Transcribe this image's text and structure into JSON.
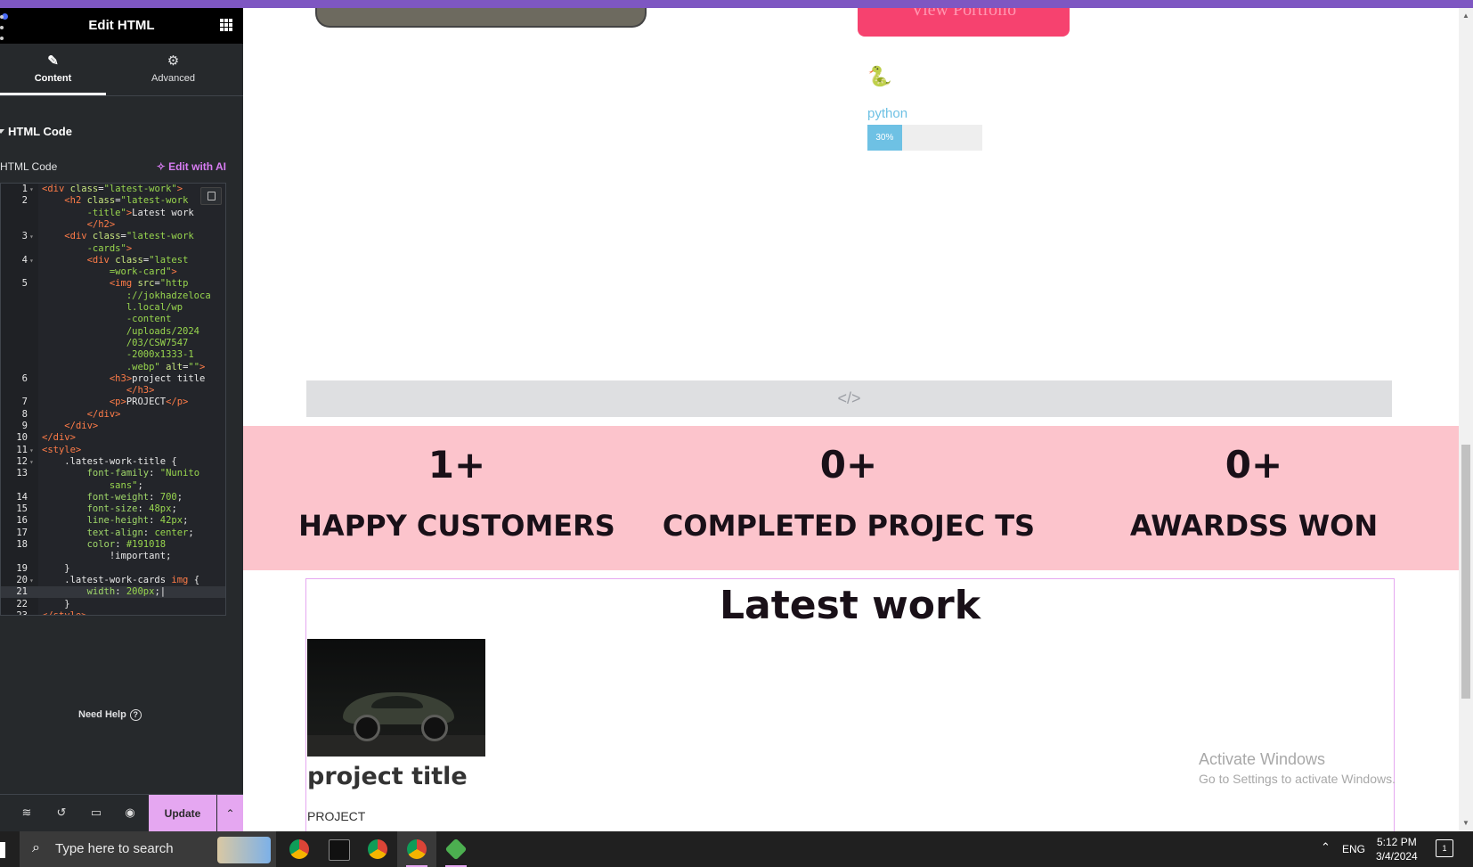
{
  "panel": {
    "title": "Edit HTML",
    "tabs": [
      {
        "label": "Content",
        "icon": "pencil-icon"
      },
      {
        "label": "Advanced",
        "icon": "gear-icon"
      }
    ],
    "section_title": "HTML Code",
    "code_label": "HTML Code",
    "edit_ai_label": "✧ Edit with AI",
    "need_help": "Need Help",
    "update_label": "Update",
    "code_lines": [
      {
        "n": "1",
        "fold": true,
        "html": "<span class=\"t-tag\">&lt;div</span> <span class=\"t-attr\">class</span>=<span class=\"t-str\">\"latest-work\"</span><span class=\"t-tag\">&gt;</span>"
      },
      {
        "n": "2",
        "fold": false,
        "html": "    <span class=\"t-tag\">&lt;h2</span> <span class=\"t-attr\">class</span>=<span class=\"t-str\">\"latest-work</span>"
      },
      {
        "n": "",
        "fold": false,
        "html": "        <span class=\"t-str\">-title\"</span><span class=\"t-tag\">&gt;</span>Latest work"
      },
      {
        "n": "",
        "fold": false,
        "html": "        <span class=\"t-tag\">&lt;/h2&gt;</span>"
      },
      {
        "n": "3",
        "fold": true,
        "html": "    <span class=\"t-tag\">&lt;div</span> <span class=\"t-attr\">class</span>=<span class=\"t-str\">\"latest-work</span>"
      },
      {
        "n": "",
        "fold": false,
        "html": "        <span class=\"t-str\">-cards\"</span><span class=\"t-tag\">&gt;</span>"
      },
      {
        "n": "4",
        "fold": true,
        "html": "        <span class=\"t-tag\">&lt;div</span> <span class=\"t-attr\">class</span>=<span class=\"t-str\">\"latest</span>"
      },
      {
        "n": "",
        "fold": false,
        "html": "            <span class=\"t-str\">=work-card\"</span><span class=\"t-tag\">&gt;</span>"
      },
      {
        "n": "5",
        "fold": false,
        "html": "            <span class=\"t-tag\">&lt;img</span> <span class=\"t-attr\">src</span>=<span class=\"t-str\">\"http</span>"
      },
      {
        "n": "",
        "fold": false,
        "html": "               <span class=\"t-str\">://jokhadzeloca</span>"
      },
      {
        "n": "",
        "fold": false,
        "html": "               <span class=\"t-str\">l.local/wp</span>"
      },
      {
        "n": "",
        "fold": false,
        "html": "               <span class=\"t-str\">-content</span>"
      },
      {
        "n": "",
        "fold": false,
        "html": "               <span class=\"t-str\">/uploads/2024</span>"
      },
      {
        "n": "",
        "fold": false,
        "html": "               <span class=\"t-str\">/03/CSW7547</span>"
      },
      {
        "n": "",
        "fold": false,
        "html": "               <span class=\"t-str\">-2000x1333-1</span>"
      },
      {
        "n": "",
        "fold": false,
        "html": "               <span class=\"t-str\">.webp\"</span> <span class=\"t-attr\">alt</span>=<span class=\"t-str\">\"\"</span><span class=\"t-tag\">&gt;</span>"
      },
      {
        "n": "6",
        "fold": false,
        "html": "            <span class=\"t-tag\">&lt;h3&gt;</span>project title"
      },
      {
        "n": "",
        "fold": false,
        "html": "               <span class=\"t-tag\">&lt;/h3&gt;</span>"
      },
      {
        "n": "7",
        "fold": false,
        "html": "            <span class=\"t-tag\">&lt;p&gt;</span>PROJECT<span class=\"t-tag\">&lt;/p&gt;</span>"
      },
      {
        "n": "8",
        "fold": false,
        "html": "        <span class=\"t-tag\">&lt;/div&gt;</span>"
      },
      {
        "n": "9",
        "fold": false,
        "html": "    <span class=\"t-tag\">&lt;/div&gt;</span>"
      },
      {
        "n": "10",
        "fold": false,
        "html": "<span class=\"t-tag\">&lt;/div&gt;</span>"
      },
      {
        "n": "11",
        "fold": true,
        "html": "<span class=\"t-tag\">&lt;style&gt;</span>"
      },
      {
        "n": "12",
        "fold": true,
        "html": "    .latest-work-title {"
      },
      {
        "n": "13",
        "fold": false,
        "html": "        <span class=\"t-prop\">font-family</span>: <span class=\"t-str\">\"Nunito</span>"
      },
      {
        "n": "",
        "fold": false,
        "html": "            <span class=\"t-str\">sans\"</span>;"
      },
      {
        "n": "14",
        "fold": false,
        "html": "        <span class=\"t-prop\">font-weight</span>: <span class=\"t-str\">700</span>;"
      },
      {
        "n": "15",
        "fold": false,
        "html": "        <span class=\"t-prop\">font-size</span>: <span class=\"t-str\">48px</span>;"
      },
      {
        "n": "16",
        "fold": false,
        "html": "        <span class=\"t-prop\">line-height</span>: <span class=\"t-str\">42px</span>;"
      },
      {
        "n": "17",
        "fold": false,
        "html": "        <span class=\"t-prop\">text-align</span>: <span class=\"t-str\">center</span>;"
      },
      {
        "n": "18",
        "fold": false,
        "html": "        <span class=\"t-prop\">color</span>: <span class=\"t-str\">#191018</span>"
      },
      {
        "n": "",
        "fold": false,
        "html": "            !important;"
      },
      {
        "n": "19",
        "fold": false,
        "html": "    }"
      },
      {
        "n": "20",
        "fold": true,
        "html": "    .latest-work-cards <span class=\"t-tag\">img</span> {"
      },
      {
        "n": "21",
        "fold": false,
        "active": true,
        "html": "        <span class=\"t-prop\">width</span>: <span class=\"t-str\">200px</span>;|"
      },
      {
        "n": "22",
        "fold": false,
        "html": "    }"
      },
      {
        "n": "23",
        "fold": false,
        "html": "<span class=\"t-tag\">&lt;/style&gt;</span>"
      }
    ]
  },
  "preview": {
    "portfolio_button": "View Portfolio",
    "python_icon": "python-icon",
    "skill_label": "python",
    "skill_percent": 30,
    "skill_percent_text": "30%",
    "html_widget_icon": "</>",
    "stats": [
      {
        "value": "1+",
        "label": "HAPPY CUSTOMERS"
      },
      {
        "value": "0+",
        "label": "COMPLETED PROJEC TS"
      },
      {
        "value": "0+",
        "label": "AWARDSS WON"
      }
    ],
    "latest_title": "Latest work",
    "project_title": "project title",
    "project_sub": "PROJECT"
  },
  "watermark": {
    "line1": "Activate Windows",
    "line2": "Go to Settings to activate Windows."
  },
  "taskbar": {
    "search_placeholder": "Type here to search",
    "language": "ENG",
    "time": "5:12 PM",
    "date": "3/4/2024",
    "notification_count": "1",
    "apps": [
      "chrome-icon",
      "terminal-icon",
      "chrome-icon",
      "chrome-profile-icon",
      "app-icon"
    ]
  },
  "colors": {
    "accent": "#e5a7f1",
    "stats_bg": "#fcc4cc",
    "skill_bar": "#6ec1e4",
    "portfolio_btn": "#f6426f"
  }
}
